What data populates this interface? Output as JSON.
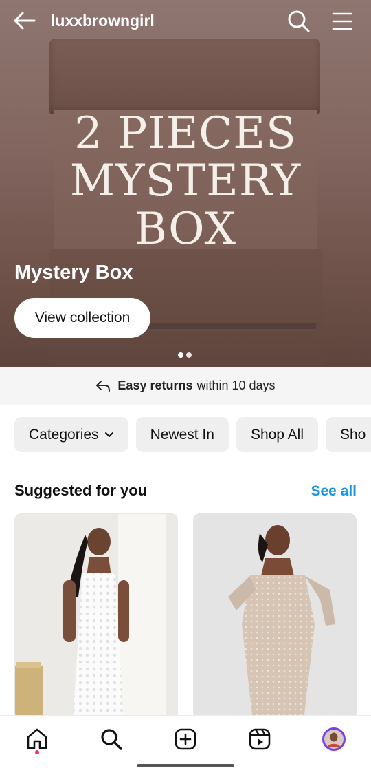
{
  "header": {
    "username": "luxxbrowngirl"
  },
  "hero": {
    "art_line1": "2 PIECES",
    "art_line2": "MYSTERY",
    "art_line3": "BOX",
    "collection_title": "Mystery Box",
    "cta_label": "View collection",
    "carousel_pages": 2,
    "carousel_active_index": 0
  },
  "returns": {
    "bold": "Easy returns",
    "rest": "within 10 days"
  },
  "chips": [
    {
      "label": "Categories",
      "has_dropdown": true
    },
    {
      "label": "Newest In"
    },
    {
      "label": "Shop All"
    },
    {
      "label": "Sho"
    }
  ],
  "suggested": {
    "title": "Suggested for you",
    "see_all": "See all"
  },
  "bottom_nav": {
    "items": [
      "home-icon",
      "search-icon",
      "create-icon",
      "reels-icon",
      "profile-avatar"
    ],
    "notification_on": "home"
  },
  "colors": {
    "link_blue": "#1a95e0",
    "hero_brown": "#7a5d55",
    "notification_red": "#ff2d55"
  }
}
